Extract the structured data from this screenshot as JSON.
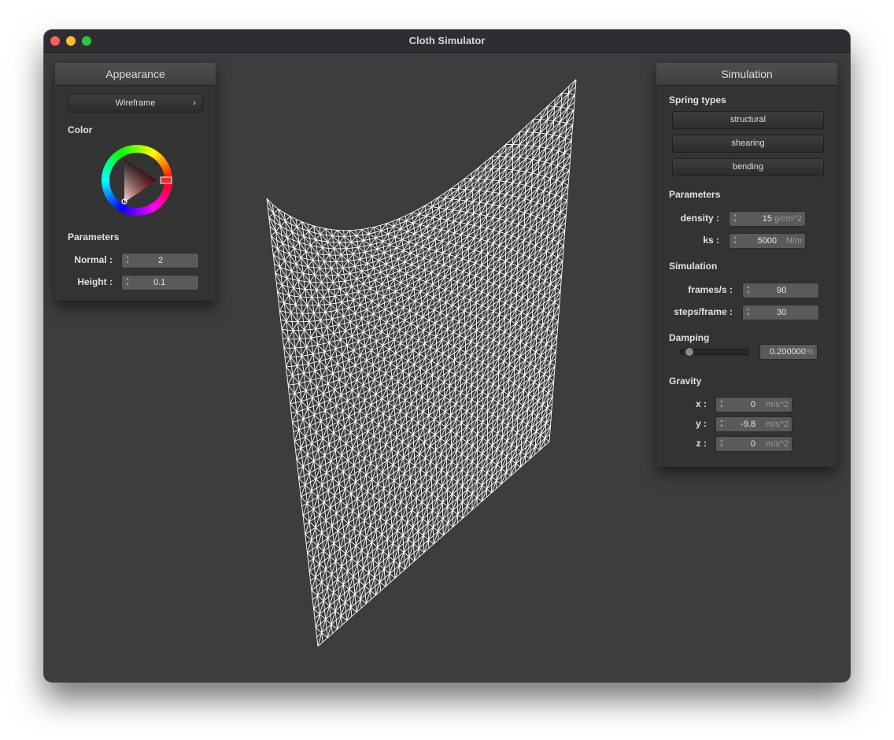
{
  "window": {
    "title": "Cloth Simulator"
  },
  "appearance": {
    "title": "Appearance",
    "shader_label": "Wireframe",
    "color_label": "Color",
    "params_label": "Parameters",
    "normal": {
      "label": "Normal :",
      "value": "2"
    },
    "height": {
      "label": "Height :",
      "value": "0.1"
    }
  },
  "simulation": {
    "title": "Simulation",
    "spring_types_label": "Spring types",
    "springs": [
      "structural",
      "shearing",
      "bending"
    ],
    "params_label": "Parameters",
    "density": {
      "label": "density :",
      "value": "15",
      "unit": "g/cm^2"
    },
    "ks": {
      "label": "ks :",
      "value": "5000",
      "unit": "N/m"
    },
    "sim_label": "Simulation",
    "fps": {
      "label": "frames/s :",
      "value": "90"
    },
    "steps": {
      "label": "steps/frame :",
      "value": "30"
    },
    "damping_label": "Damping",
    "damping": {
      "value": "0.200000",
      "unit": "%",
      "slider_fraction": 0.08
    },
    "gravity_label": "Gravity",
    "gx": {
      "label": "x :",
      "value": "0",
      "unit": "m/s^2"
    },
    "gy": {
      "label": "y :",
      "value": "-9.8",
      "unit": "m/s^2"
    },
    "gz": {
      "label": "z :",
      "value": "0",
      "unit": "m/s^2"
    }
  },
  "colors": {
    "background": "#3d3d3d",
    "cloth": "#ffffff",
    "selected_color": "#e02020"
  }
}
